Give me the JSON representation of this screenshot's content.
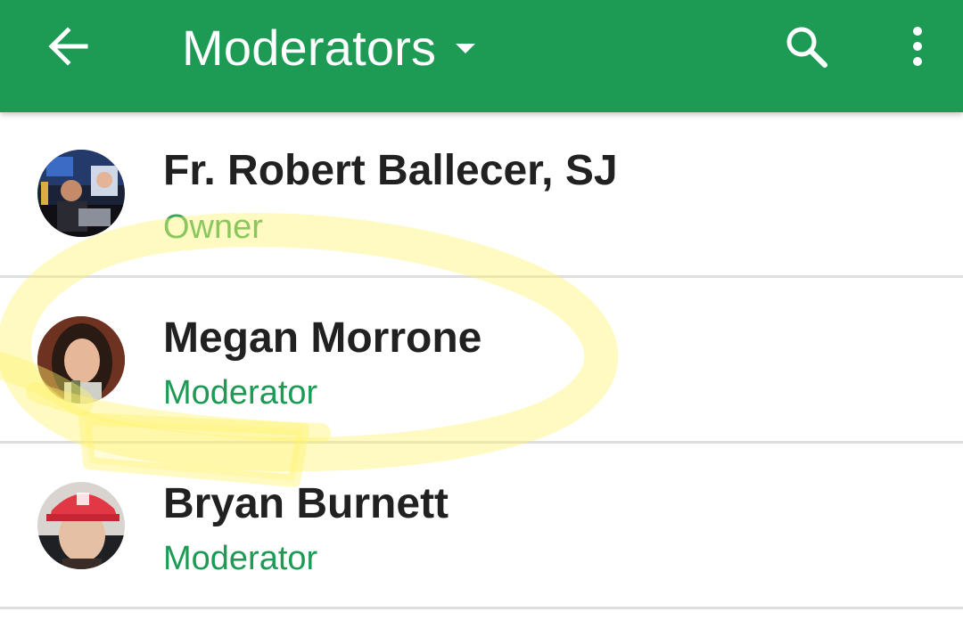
{
  "appbar": {
    "title": "Moderators",
    "back_icon": "arrow-back-icon",
    "dropdown_icon": "chevron-down-icon",
    "search_icon": "search-icon",
    "more_icon": "more-vert-icon",
    "background_color": "#1d9b55",
    "foreground_color": "#ffffff"
  },
  "members": [
    {
      "name": "Fr. Robert Ballecer, SJ",
      "role": "Owner"
    },
    {
      "name": "Megan Morrone",
      "role": "Moderator"
    },
    {
      "name": "Bryan Burnett",
      "role": "Moderator"
    }
  ],
  "colors": {
    "accent": "#1d9b55",
    "highlight": "#fff59d",
    "divider": "#dedede"
  }
}
